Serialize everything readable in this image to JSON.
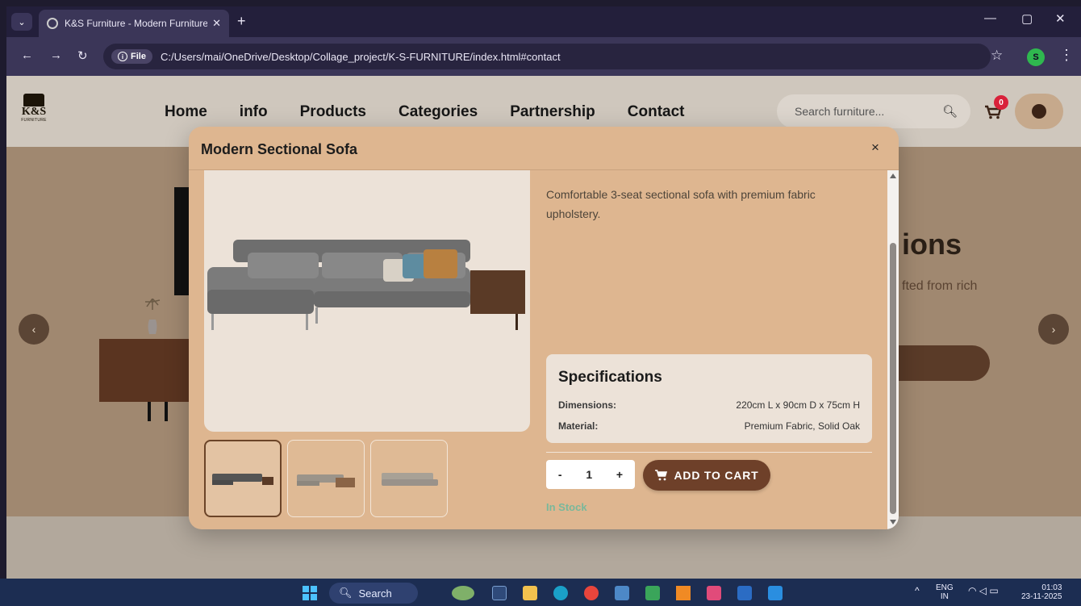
{
  "browser": {
    "tab_title": "K&S Furniture - Modern Furniture",
    "tab_close": "✕",
    "new_tab": "+",
    "file_chip": "File",
    "url": "C:/Users/mai/OneDrive/Desktop/Collage_project/K-S-FURNITURE/index.html#contact",
    "profile_initial": "S"
  },
  "site": {
    "logo_text": "K&S",
    "logo_sub": "FURNITURE",
    "nav": [
      {
        "label": "Home"
      },
      {
        "label": "info"
      },
      {
        "label": "Products"
      },
      {
        "label": "Categories"
      },
      {
        "label": "Partnership"
      },
      {
        "label": "Contact"
      }
    ],
    "search_placeholder": "Search furniture...",
    "cart_count": "0",
    "hero_title_fragment": "ions",
    "hero_sub_fragment": "fted from rich",
    "slider_prev": "‹",
    "slider_next": "›"
  },
  "modal": {
    "title": "Modern Sectional Sofa",
    "close": "×",
    "description": "Comfortable 3-seat sectional sofa with premium fabric upholstery.",
    "specs_heading": "Specifications",
    "specs": [
      {
        "key": "Dimensions:",
        "value": "220cm L x 90cm D x 75cm H"
      },
      {
        "key": "Material:",
        "value": "Premium Fabric, Solid Oak"
      }
    ],
    "qty_minus": "-",
    "qty_value": "1",
    "qty_plus": "+",
    "add_to_cart": "ADD TO CART",
    "stock": "In Stock"
  },
  "taskbar": {
    "search_label": "Search",
    "lang_top": "ENG",
    "lang_bottom": "IN",
    "time": "01:03",
    "date": "23-11-2025"
  }
}
